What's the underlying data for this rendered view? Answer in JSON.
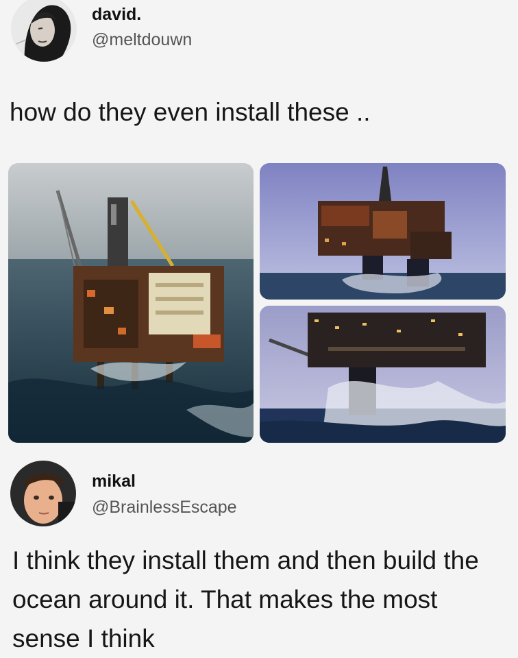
{
  "tweet": {
    "author_name": "david.",
    "author_handle": "@meltdouwn",
    "text": "how do they even install these ..",
    "avatar_icon": "profile-photo-icon",
    "media": [
      {
        "subject": "offshore-oil-platform-photo"
      },
      {
        "subject": "offshore-oil-platform-photo"
      },
      {
        "subject": "offshore-oil-platform-photo"
      }
    ]
  },
  "reply": {
    "author_name": "mikal",
    "author_handle": "@BrainlessEscape",
    "text": "I think they install them and then build the ocean around it. That makes the most sense I think",
    "avatar_icon": "profile-photo-icon"
  },
  "colors": {
    "background": "#f4f4f4",
    "text": "#161616",
    "handle": "#555555",
    "sea_dark": "#1f3a4e",
    "sky_gray": "#c9cfd3",
    "sky_purple": "#8d8fc4",
    "platform_rust": "#7a3b1e"
  }
}
